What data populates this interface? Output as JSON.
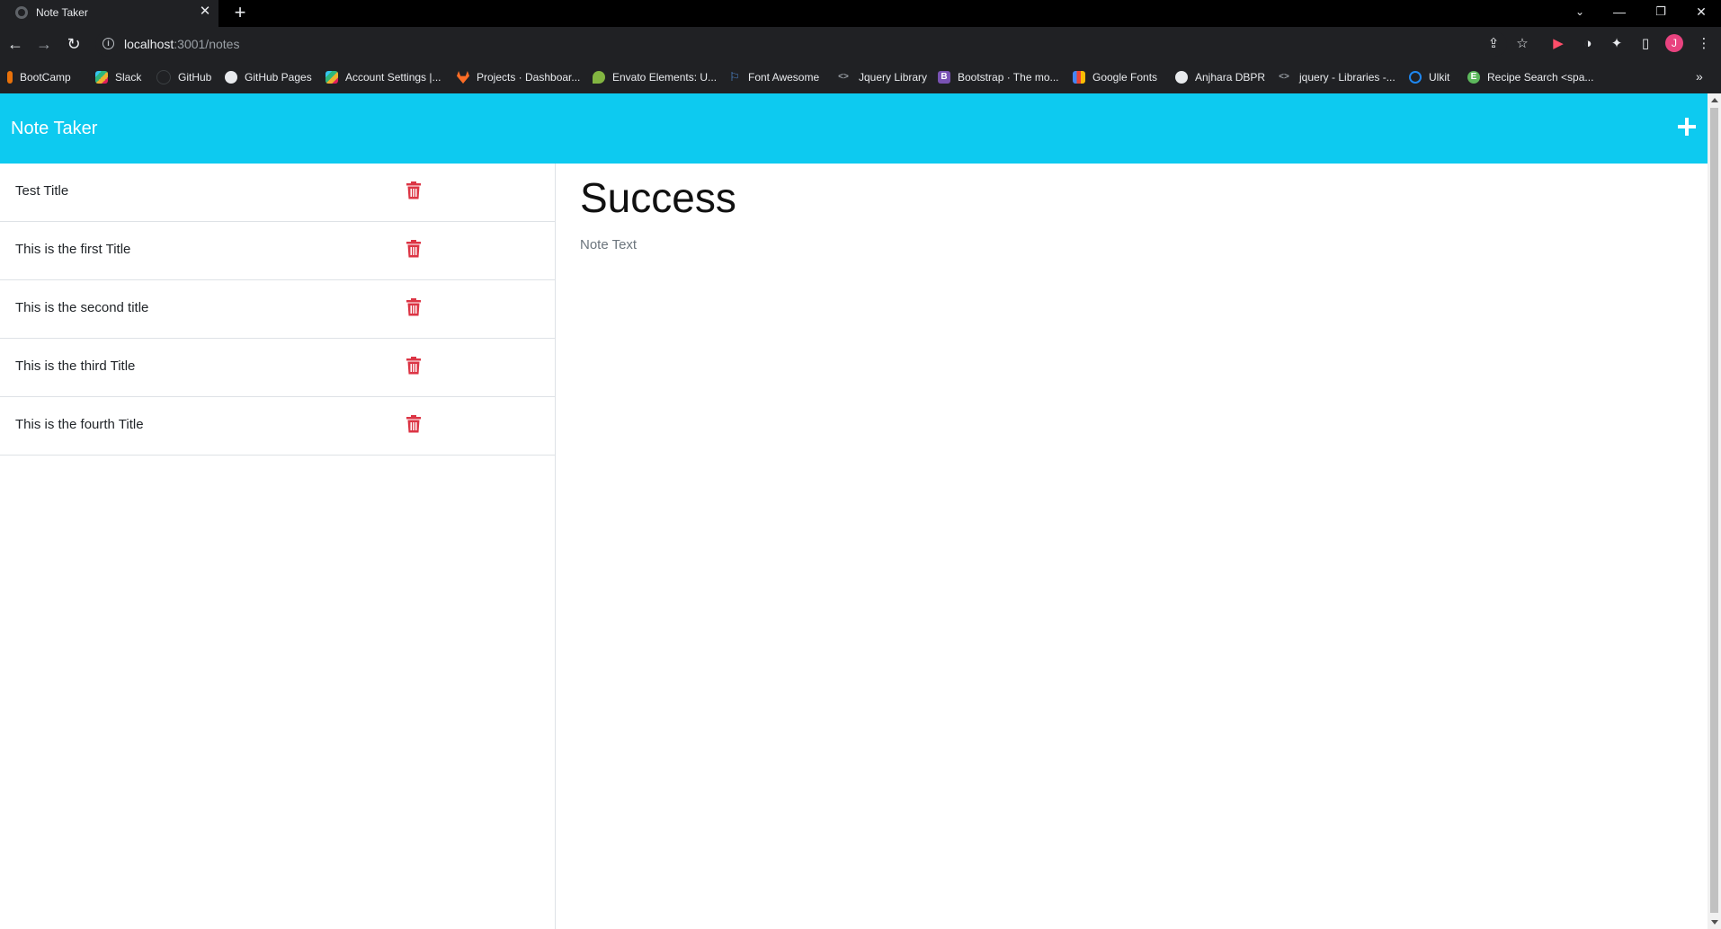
{
  "browser": {
    "tab_title": "Note Taker",
    "url_host": "localhost",
    "url_rest": ":3001/notes",
    "profile_initial": "J",
    "bookmarks": [
      {
        "label": "BootCamp",
        "icon": "bootcamp-icon",
        "color": "#e8710a"
      },
      {
        "label": "Slack",
        "icon": "slack-icon",
        "color": "#4a154b"
      },
      {
        "label": "GitHub",
        "icon": "github-icon",
        "color": "#202124"
      },
      {
        "label": "GitHub Pages",
        "icon": "github-icon",
        "color": "#202124"
      },
      {
        "label": "Account Settings |...",
        "icon": "slack-icon",
        "color": "#4a154b"
      },
      {
        "label": "Projects · Dashboar...",
        "icon": "gitlab-icon",
        "color": "#fc6d26"
      },
      {
        "label": "Envato Elements: U...",
        "icon": "envato-icon",
        "color": "#82b541"
      },
      {
        "label": "Font Awesome",
        "icon": "flag-icon",
        "color": "#528dd7"
      },
      {
        "label": "Jquery Library",
        "icon": "code-icon",
        "color": "#9aa0a6"
      },
      {
        "label": "Bootstrap · The mo...",
        "icon": "bootstrap-icon",
        "color": "#7952b3"
      },
      {
        "label": "Google Fonts",
        "icon": "google-fonts-icon",
        "color": "#4285f4"
      },
      {
        "label": "Anjhara DBPR",
        "icon": "globe-icon",
        "color": "#e8eaed"
      },
      {
        "label": "jquery - Libraries -...",
        "icon": "code-icon",
        "color": "#9aa0a6"
      },
      {
        "label": "Ulkit",
        "icon": "uikit-icon",
        "color": "#1e87f0"
      },
      {
        "label": "Recipe Search <spa...",
        "icon": "recipe-icon",
        "color": "#5cb85c"
      }
    ]
  },
  "app": {
    "brand": "Note Taker",
    "accent_color": "#0dcaf0",
    "delete_color": "#dc3545",
    "notes": [
      {
        "title": "Test Title"
      },
      {
        "title": "This is the first Title"
      },
      {
        "title": "This is the second title"
      },
      {
        "title": "This is the third Title"
      },
      {
        "title": "This is the fourth Title"
      }
    ],
    "active_note": {
      "title": "Success",
      "text": "Note Text"
    }
  }
}
